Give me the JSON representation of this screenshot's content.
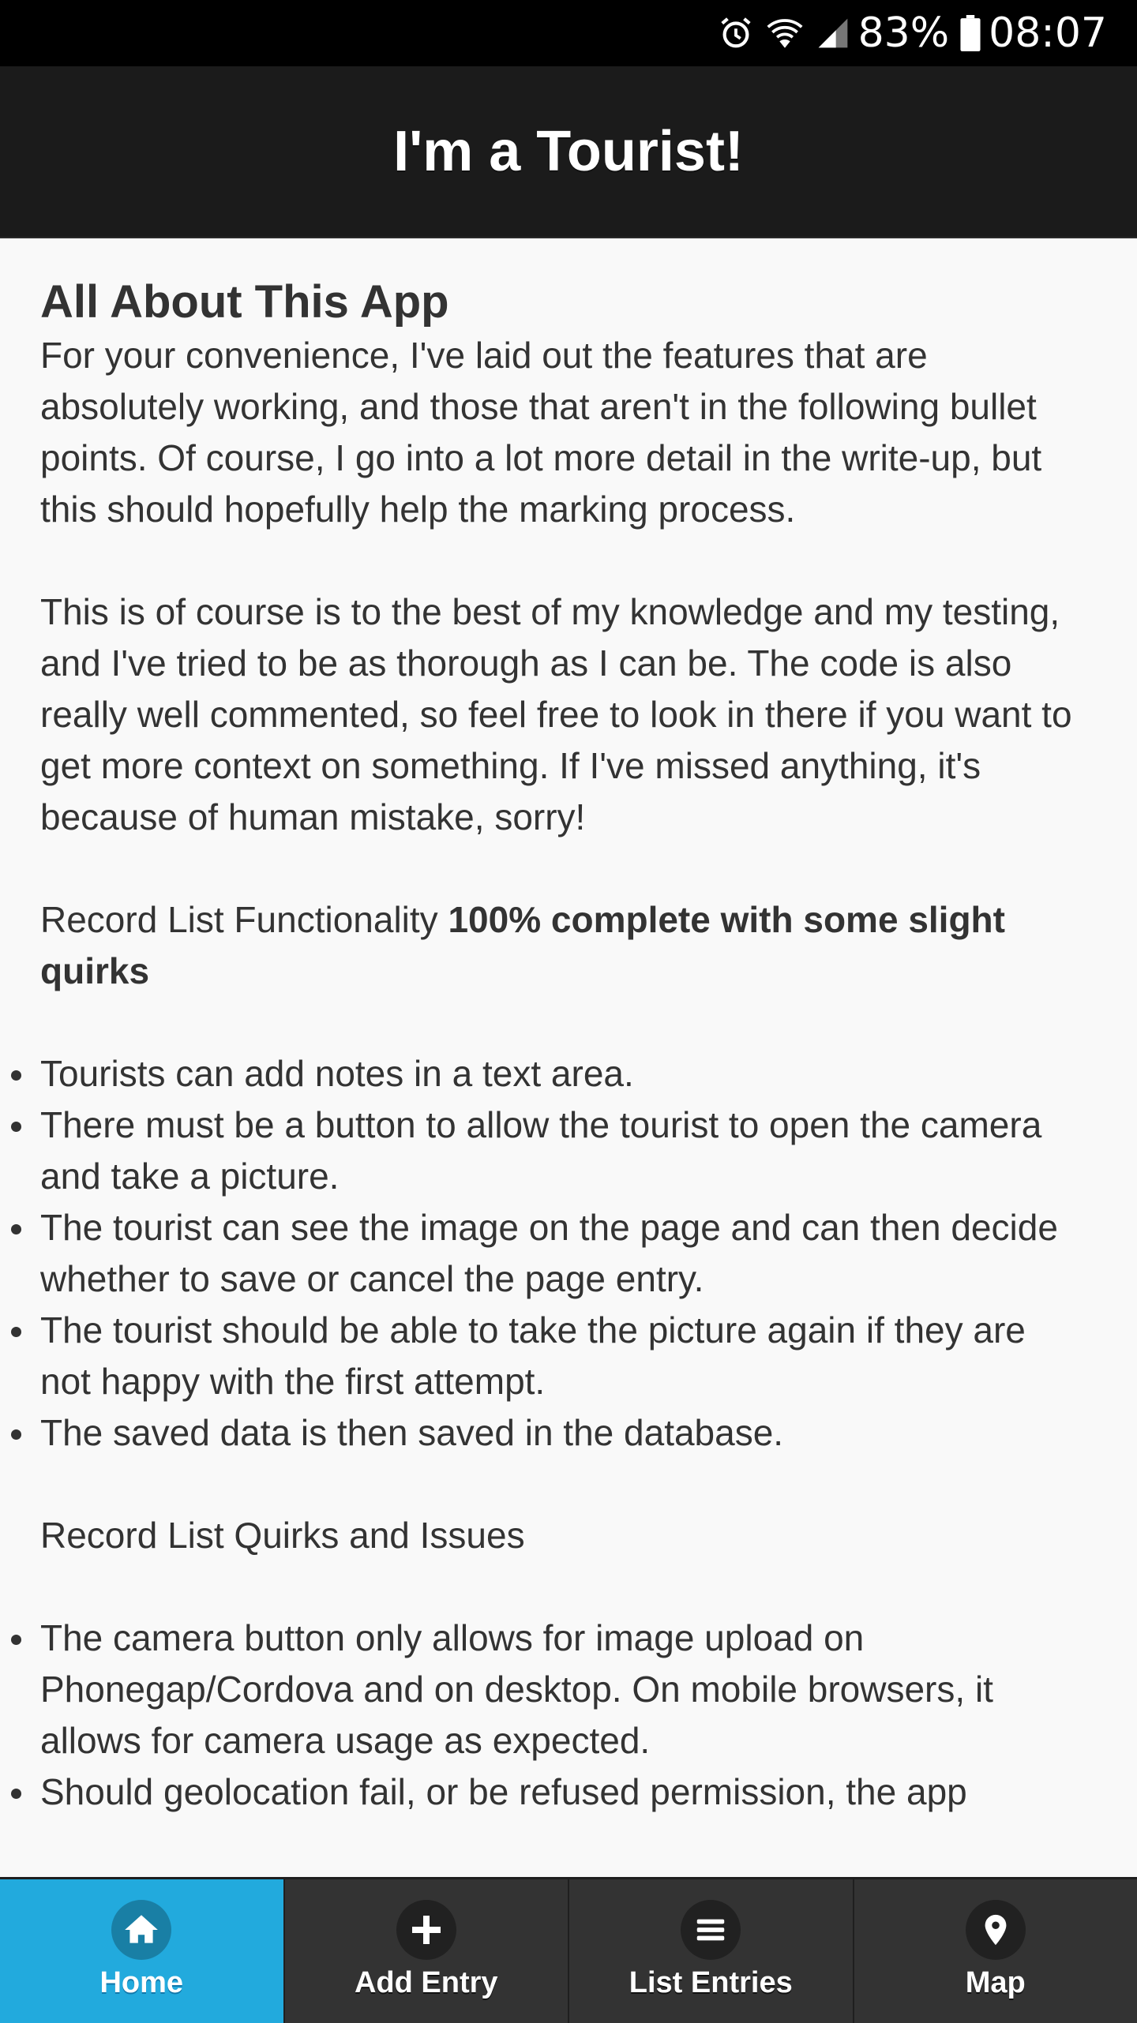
{
  "status_bar": {
    "battery_percent": "83%",
    "time": "08:07",
    "icons": [
      "alarm-icon",
      "wifi-icon",
      "signal-icon",
      "battery-icon"
    ]
  },
  "header": {
    "title": "I'm a Tourist!"
  },
  "content": {
    "heading": "All About This App",
    "intro_paragraph": "For your convenience, I've laid out the features that are absolutely working, and those that aren't in the following bullet points. Of course, I go into a lot more detail in the write-up, but this should hopefully help the marking process.",
    "second_paragraph": "This is of course is to the best of my knowledge and my testing, and I've tried to be as thorough as I can be. The code is also really well commented, so feel free to look in there if you want to get more context on something. If I've missed anything, it's because of human mistake, sorry!",
    "section1": {
      "label": "Record List Functionality ",
      "status": "100% complete with some slight quirks",
      "items": [
        "Tourists can add notes in a text area.",
        "There must be a button to allow the tourist to open the camera and take a picture.",
        "The tourist can see the image on the page and can then decide whether to save or cancel the page entry.",
        "The tourist should be able to take the picture again if they are not happy with the first attempt.",
        "The saved data is then saved in the database."
      ]
    },
    "section2": {
      "label": "Record List Quirks and Issues",
      "items": [
        "The camera button only allows for image upload on Phonegap/Cordova and on desktop. On mobile browsers, it allows for camera usage as expected.",
        "Should geolocation fail, or be refused permission, the app"
      ]
    }
  },
  "navbar": {
    "items": [
      {
        "label": "Home",
        "icon": "home-icon",
        "active": true
      },
      {
        "label": "Add Entry",
        "icon": "plus-icon",
        "active": false
      },
      {
        "label": "List Entries",
        "icon": "list-icon",
        "active": false
      },
      {
        "label": "Map",
        "icon": "map-pin-icon",
        "active": false
      }
    ],
    "active_color": "#22aadd",
    "bar_color": "#333333"
  }
}
